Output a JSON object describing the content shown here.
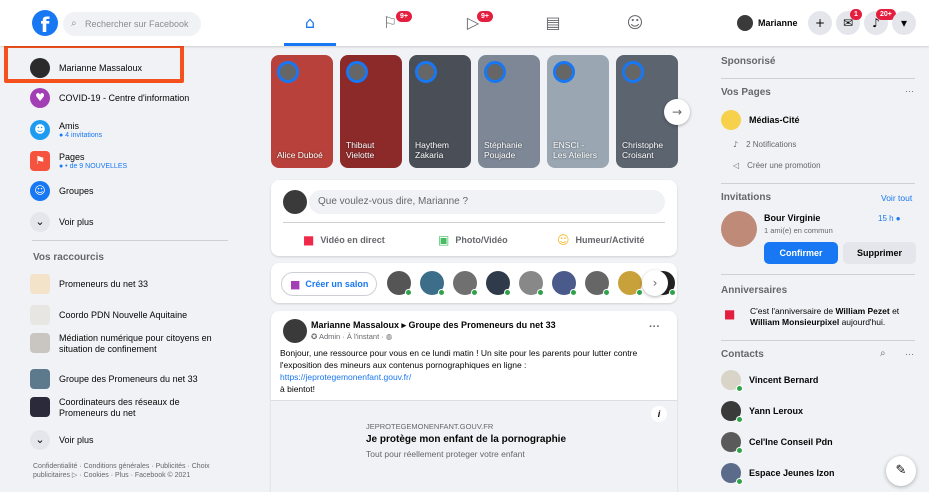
{
  "topbar": {
    "search_placeholder": "Rechercher sur Facebook",
    "user_name": "Marianne",
    "badges": {
      "pages": "9+",
      "watch": "9+",
      "messenger": "1",
      "notifications": "20+"
    }
  },
  "left": {
    "profile": "Marianne Massaloux",
    "covid": "COVID-19 - Centre d'information",
    "friends": {
      "label": "Amis",
      "sub": "● 4 invitations"
    },
    "pages": {
      "label": "Pages",
      "sub": "● • de 9 NOUVELLES"
    },
    "groups": "Groupes",
    "see_more": "Voir plus",
    "shortcuts_title": "Vos raccourcis",
    "shortcuts": [
      "Promeneurs du net 33",
      "Coordo PDN Nouvelle Aquitaine",
      "Médiation numérique pour citoyens en situation de confinement",
      "Groupe des Promeneurs du net 33",
      "Coordinateurs des réseaux de Promeneurs du net"
    ],
    "see_more_2": "Voir plus",
    "footer": "Confidentialité · Conditions générales · Publicités · Choix publicitaires ▷ · Cookies · Plus · Facebook © 2021"
  },
  "stories": [
    {
      "name": "Alice Duboé",
      "color": "#b9413b"
    },
    {
      "name": "Thibaut Vielotte",
      "color": "#8c2a2a"
    },
    {
      "name": "Haythem Zakaria",
      "color": "#4a4f57"
    },
    {
      "name": "Stéphanie Poujade",
      "color": "#7d8796"
    },
    {
      "name": "ENSCI - Les Ateliers",
      "color": "#9aa7b3"
    },
    {
      "name": "Christophe Croisant",
      "color": "#5c6470"
    }
  ],
  "composer": {
    "placeholder": "Que voulez-vous dire, Marianne ?",
    "live": "Vidéo en direct",
    "photo": "Photo/Vidéo",
    "feeling": "Humeur/Activité"
  },
  "rooms": {
    "create": "Créer un salon"
  },
  "post": {
    "author": "Marianne Massaloux ▸ Groupe des Promeneurs du net 33",
    "meta": "✪ Admin · À l'instant · ◍",
    "text": "Bonjour, une ressource pour vous en ce lundi matin ! Un site pour les parents pour lutter contre l'exposition des mineurs aux contenus pornographiques en ligne :",
    "link": "https://jeprotegemonenfant.gouv.fr/",
    "closing": "à bientot!",
    "preview_domain": "JEPROTEGEMONENFANT.GOUV.FR",
    "preview_title": "Je protège mon enfant de la pornographie",
    "preview_desc": "Tout pour réellement proteger votre enfant",
    "menu": "···",
    "info": "i"
  },
  "right": {
    "sponsored": "Sponsorisé",
    "your_pages": "Vos Pages",
    "page_name": "Médias-Cité",
    "notifications": "2 Notifications",
    "create_promo": "Créer une promotion",
    "invitations": "Invitations",
    "see_all": "Voir tout",
    "invite_name": "Bour Virginie",
    "invite_time": "15 h",
    "invite_mutual": "1 ami(e) en commun",
    "confirm": "Confirmer",
    "delete": "Supprimer",
    "birthdays": "Anniversaires",
    "birthday_text_pre": "C'est l'anniversaire de ",
    "birthday_name1": "William Pezet",
    "birthday_mid": " et ",
    "birthday_name2": "William Monsieurpixel",
    "birthday_post": " aujourd'hui.",
    "contacts_title": "Contacts",
    "contacts": [
      "Vincent Bernard",
      "Yann Leroux",
      "Cel'Ine Conseil Pdn",
      "Espace Jeunes Izon"
    ]
  }
}
